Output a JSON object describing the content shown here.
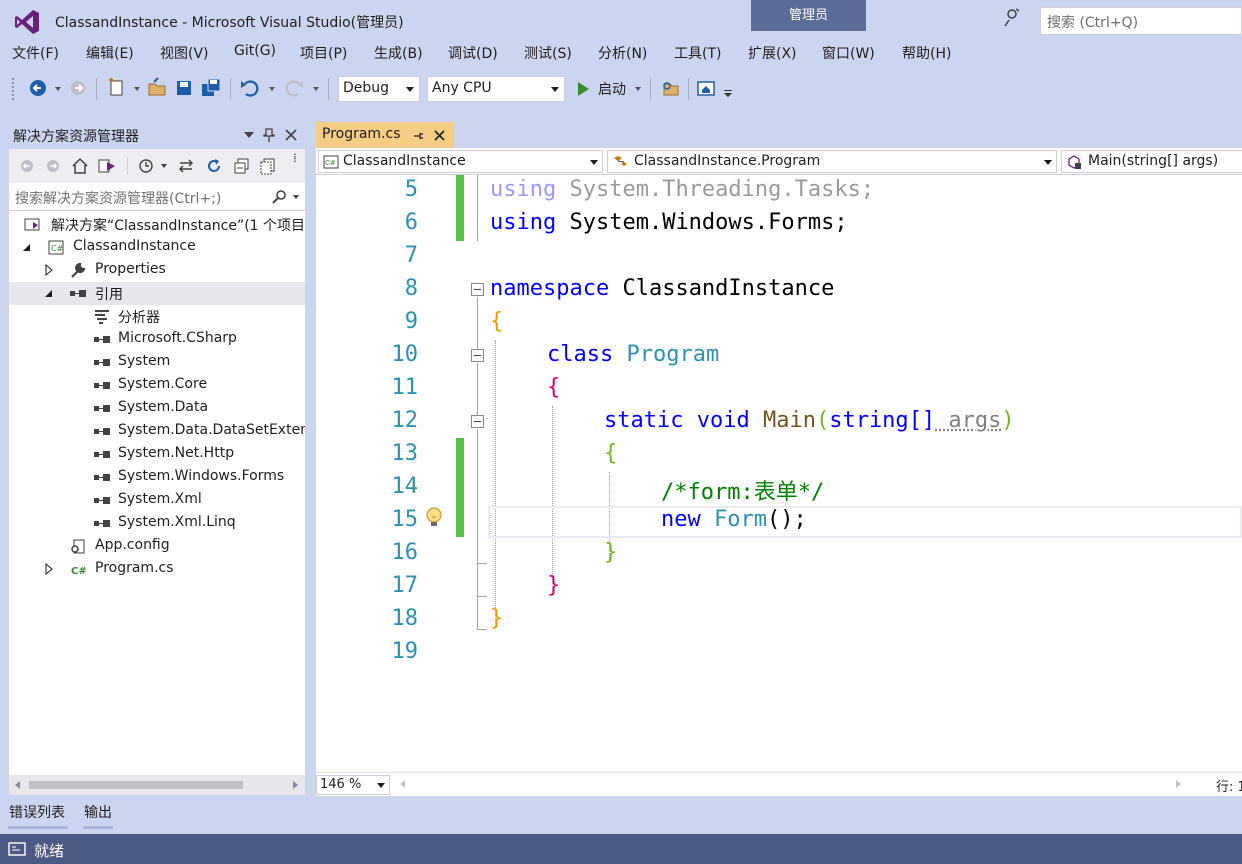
{
  "window": {
    "title": "ClassandInstance - Microsoft Visual Studio(管理员)",
    "admin_badge": "管理员",
    "search_placeholder": "搜索 (Ctrl+Q)"
  },
  "menu": [
    "文件(F)",
    "编辑(E)",
    "视图(V)",
    "Git(G)",
    "项目(P)",
    "生成(B)",
    "调试(D)",
    "测试(S)",
    "分析(N)",
    "工具(T)",
    "扩展(X)",
    "窗口(W)",
    "帮助(H)"
  ],
  "toolbar": {
    "configuration": "Debug",
    "platform": "Any CPU",
    "start_label": "启动"
  },
  "solution_explorer": {
    "title": "解决方案资源管理器",
    "search_placeholder": "搜索解决方案资源管理器(Ctrl+;)",
    "tree": [
      {
        "label": "解决方案“ClassandInstance”(1 个项目",
        "icon": "solution-icon"
      },
      {
        "label": "ClassandInstance",
        "icon": "csharp-project-icon"
      },
      {
        "label": "Properties",
        "icon": "wrench-icon"
      },
      {
        "label": "引用",
        "icon": "reference-icon"
      },
      {
        "label": "分析器",
        "icon": "analyzer-icon"
      },
      {
        "label": "Microsoft.CSharp",
        "icon": "reference-icon"
      },
      {
        "label": "System",
        "icon": "reference-icon"
      },
      {
        "label": "System.Core",
        "icon": "reference-icon"
      },
      {
        "label": "System.Data",
        "icon": "reference-icon"
      },
      {
        "label": "System.Data.DataSetExten",
        "icon": "reference-icon"
      },
      {
        "label": "System.Net.Http",
        "icon": "reference-icon"
      },
      {
        "label": "System.Windows.Forms",
        "icon": "reference-icon"
      },
      {
        "label": "System.Xml",
        "icon": "reference-icon"
      },
      {
        "label": "System.Xml.Linq",
        "icon": "reference-icon"
      },
      {
        "label": "App.config",
        "icon": "config-icon"
      },
      {
        "label": "Program.cs",
        "icon": "csharp-file-icon"
      }
    ]
  },
  "editor": {
    "tab_label": "Program.cs",
    "nav": {
      "project": "ClassandInstance",
      "type": "ClassandInstance.Program",
      "member": "Main(string[] args)"
    },
    "line_numbers": [
      "5",
      "6",
      "7",
      "8",
      "9",
      "10",
      "11",
      "12",
      "13",
      "14",
      "15",
      "16",
      "17",
      "18",
      "19"
    ],
    "code": {
      "l5_kw": "using",
      "l5_rest": " System.Threading.Tasks;",
      "l6_kw": "using",
      "l6_rest": " System.Windows.Forms;",
      "l8_kw": "namespace",
      "l8_rest": " ClassandInstance",
      "l9": "{",
      "l10_kw": "class",
      "l10_name": " Program",
      "l11": "{",
      "l12_kw1": "static",
      "l12_kw2": " void",
      "l12_method": " Main",
      "l12_paren": "(",
      "l12_type": "string",
      "l12_brackets": "[]",
      "l12_arg": " args",
      "l12_close": ")",
      "l13": "{",
      "l14_comment": "/*form:表单*/",
      "l15_kw": "new",
      "l15_type": " Form",
      "l15_rest": "();",
      "l16": "}",
      "l17": "}",
      "l18": "}"
    },
    "zoom": "146 %",
    "line_indicator": "行: 1"
  },
  "bottom_tabs": [
    "错误列表",
    "输出"
  ],
  "status": {
    "text": "就绪"
  }
}
